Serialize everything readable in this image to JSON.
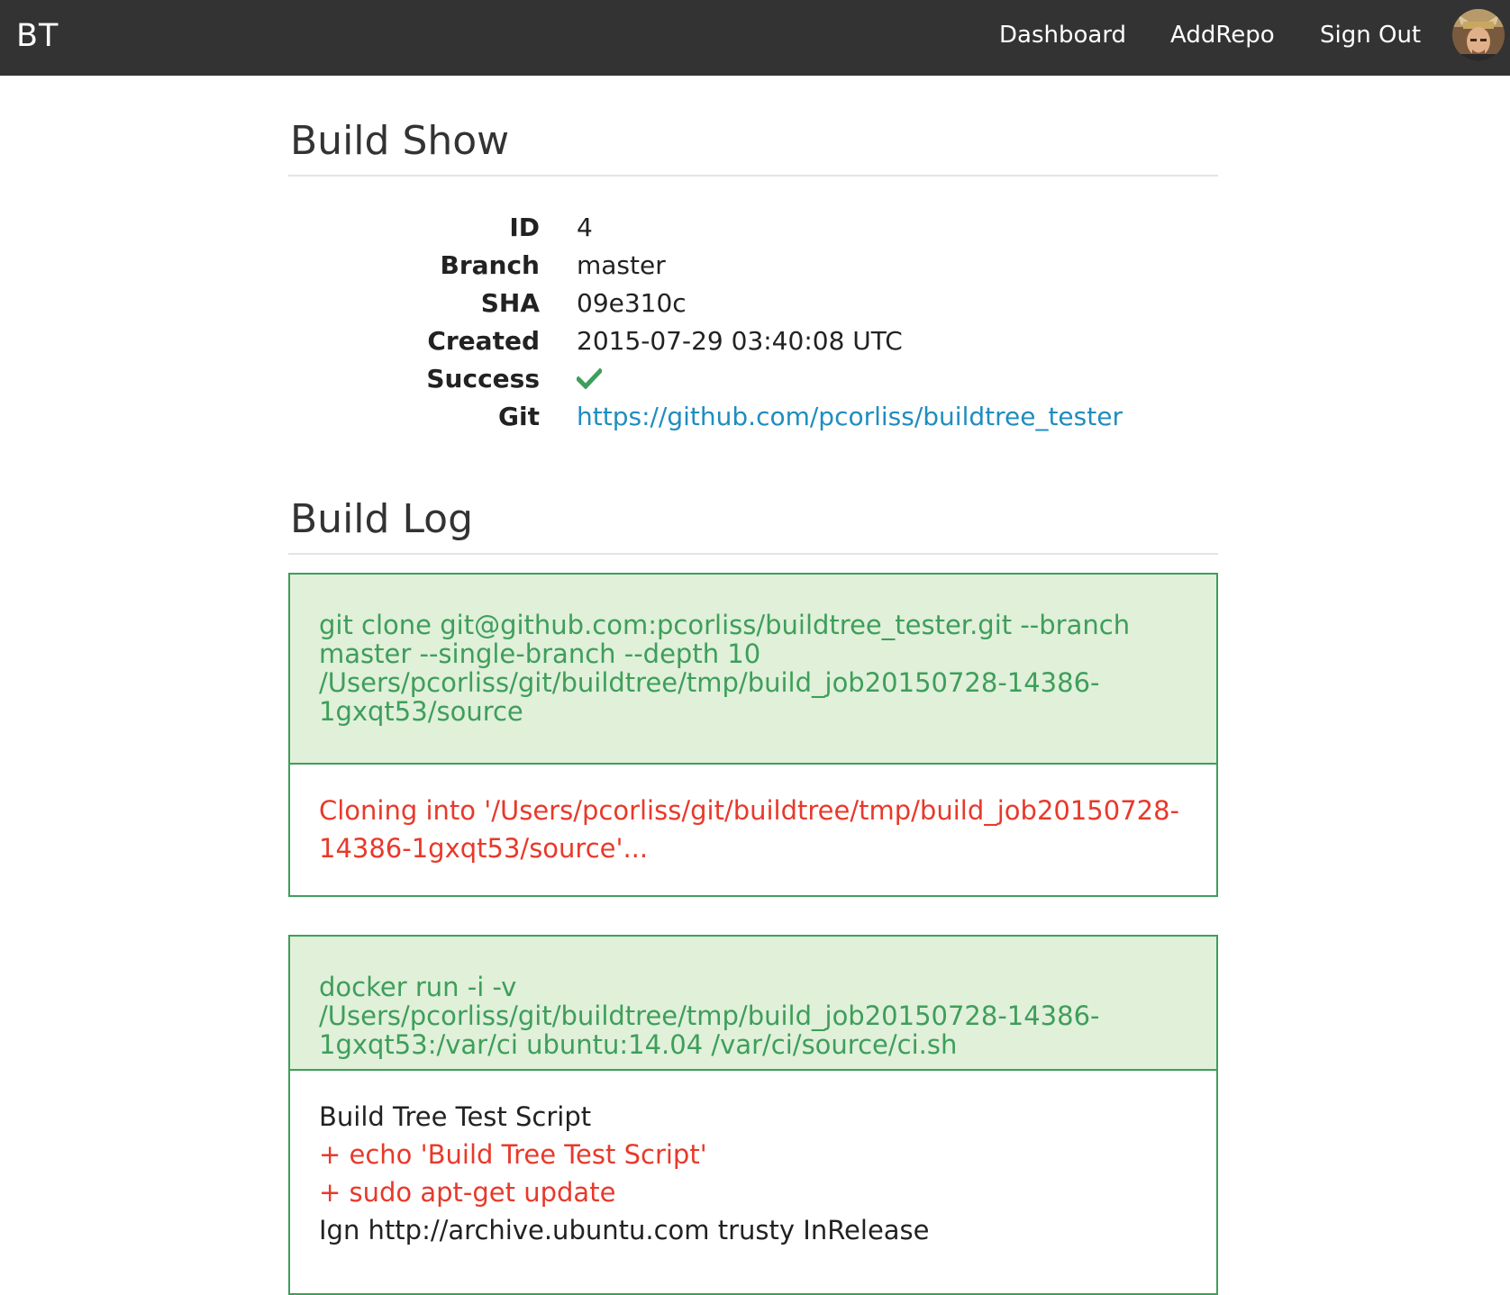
{
  "navbar": {
    "brand": "BT",
    "links": {
      "dashboard": "Dashboard",
      "addrepo": "AddRepo",
      "signout": "Sign Out"
    }
  },
  "build_show": {
    "title": "Build Show",
    "fields": [
      {
        "label": "ID",
        "value": "4"
      },
      {
        "label": "Branch",
        "value": "master"
      },
      {
        "label": "SHA",
        "value": "09e310c"
      },
      {
        "label": "Created",
        "value": "2015-07-29 03:40:08 UTC"
      },
      {
        "label": "Success",
        "value": "",
        "icon": "check-icon"
      },
      {
        "label": "Git",
        "value": "https://github.com/pcorliss/buildtree_tester"
      }
    ]
  },
  "build_log": {
    "title": "Build Log",
    "entries": [
      {
        "command": "git clone git@github.com:pcorliss/buildtree_tester.git --branch master --single-branch --depth 10 /Users/pcorliss/git/buildtree/tmp/build_job20150728-14386-1gxqt53/source",
        "output": [
          {
            "stream": "stderr",
            "text": "Cloning into '/Users/pcorliss/git/buildtree/tmp/build_job20150728-14386-1gxqt53/source'..."
          }
        ]
      },
      {
        "command": "docker run -i -v /Users/pcorliss/git/buildtree/tmp/build_job20150728-14386-1gxqt53:/var/ci ubuntu:14.04 /var/ci/source/ci.sh",
        "output": [
          {
            "stream": "stdout",
            "text": "Build Tree Test Script"
          },
          {
            "stream": "stderr",
            "text": "+ echo 'Build Tree Test Script'"
          },
          {
            "stream": "stderr",
            "text": "+ sudo apt-get update"
          },
          {
            "stream": "stdout",
            "text": "Ign http://archive.ubuntu.com trusty InRelease"
          }
        ]
      }
    ]
  },
  "colors": {
    "navbar_bg": "#333333",
    "success_green": "#3e9e5b",
    "command_bg": "#e0f0d9",
    "stderr_red": "#e8392a",
    "link_blue": "#1f8dbf"
  }
}
